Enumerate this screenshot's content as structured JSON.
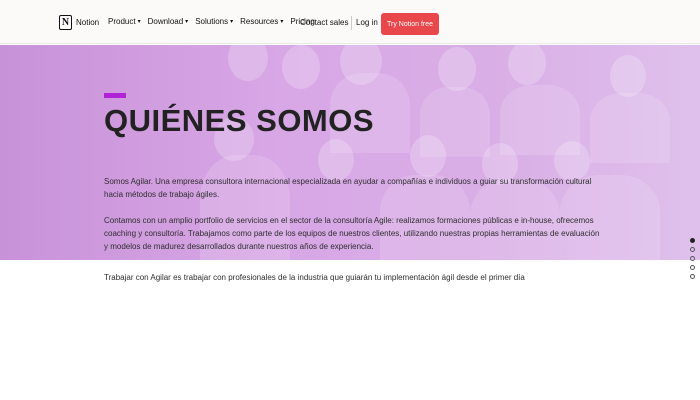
{
  "nav": {
    "logo_text": "Notion",
    "logo_letter": "N",
    "items": [
      {
        "label": "Product",
        "dropdown": true
      },
      {
        "label": "Download",
        "dropdown": true
      },
      {
        "label": "Solutions",
        "dropdown": true
      },
      {
        "label": "Resources",
        "dropdown": true
      },
      {
        "label": "Pricing",
        "dropdown": false
      }
    ],
    "contact_sales": "Contact sales",
    "login": "Log in",
    "cta": "Try Notion free"
  },
  "hero": {
    "title": "QUIÉNES SOMOS",
    "accent_color": "#b024d6",
    "overlay_color": "#d8a7e6"
  },
  "content": {
    "paragraph1": "Somos Agilar. Una empresa consultora internacional especializada en ayudar a compañías e individuos a guiar su transformación cultural hacia métodos de trabajo ágiles.",
    "paragraph2": "Contamos con un amplio portfolio de servicios en el sector de la consultoría Agile: realizamos formaciones públicas e in-house, ofrecemos coaching y consultoría. Trabajamos como parte de los equipos de nuestros clientes, utilizando nuestras propias herramientas de evaluación y modelos de madurez desarrollados durante nuestros años de experiencia.",
    "paragraph3": "Trabajar con Agilar es trabajar con profesionales de la industria que guiarán tu implementación ágil desde el primer día"
  },
  "colors": {
    "cta_bg": "#e8474b"
  }
}
